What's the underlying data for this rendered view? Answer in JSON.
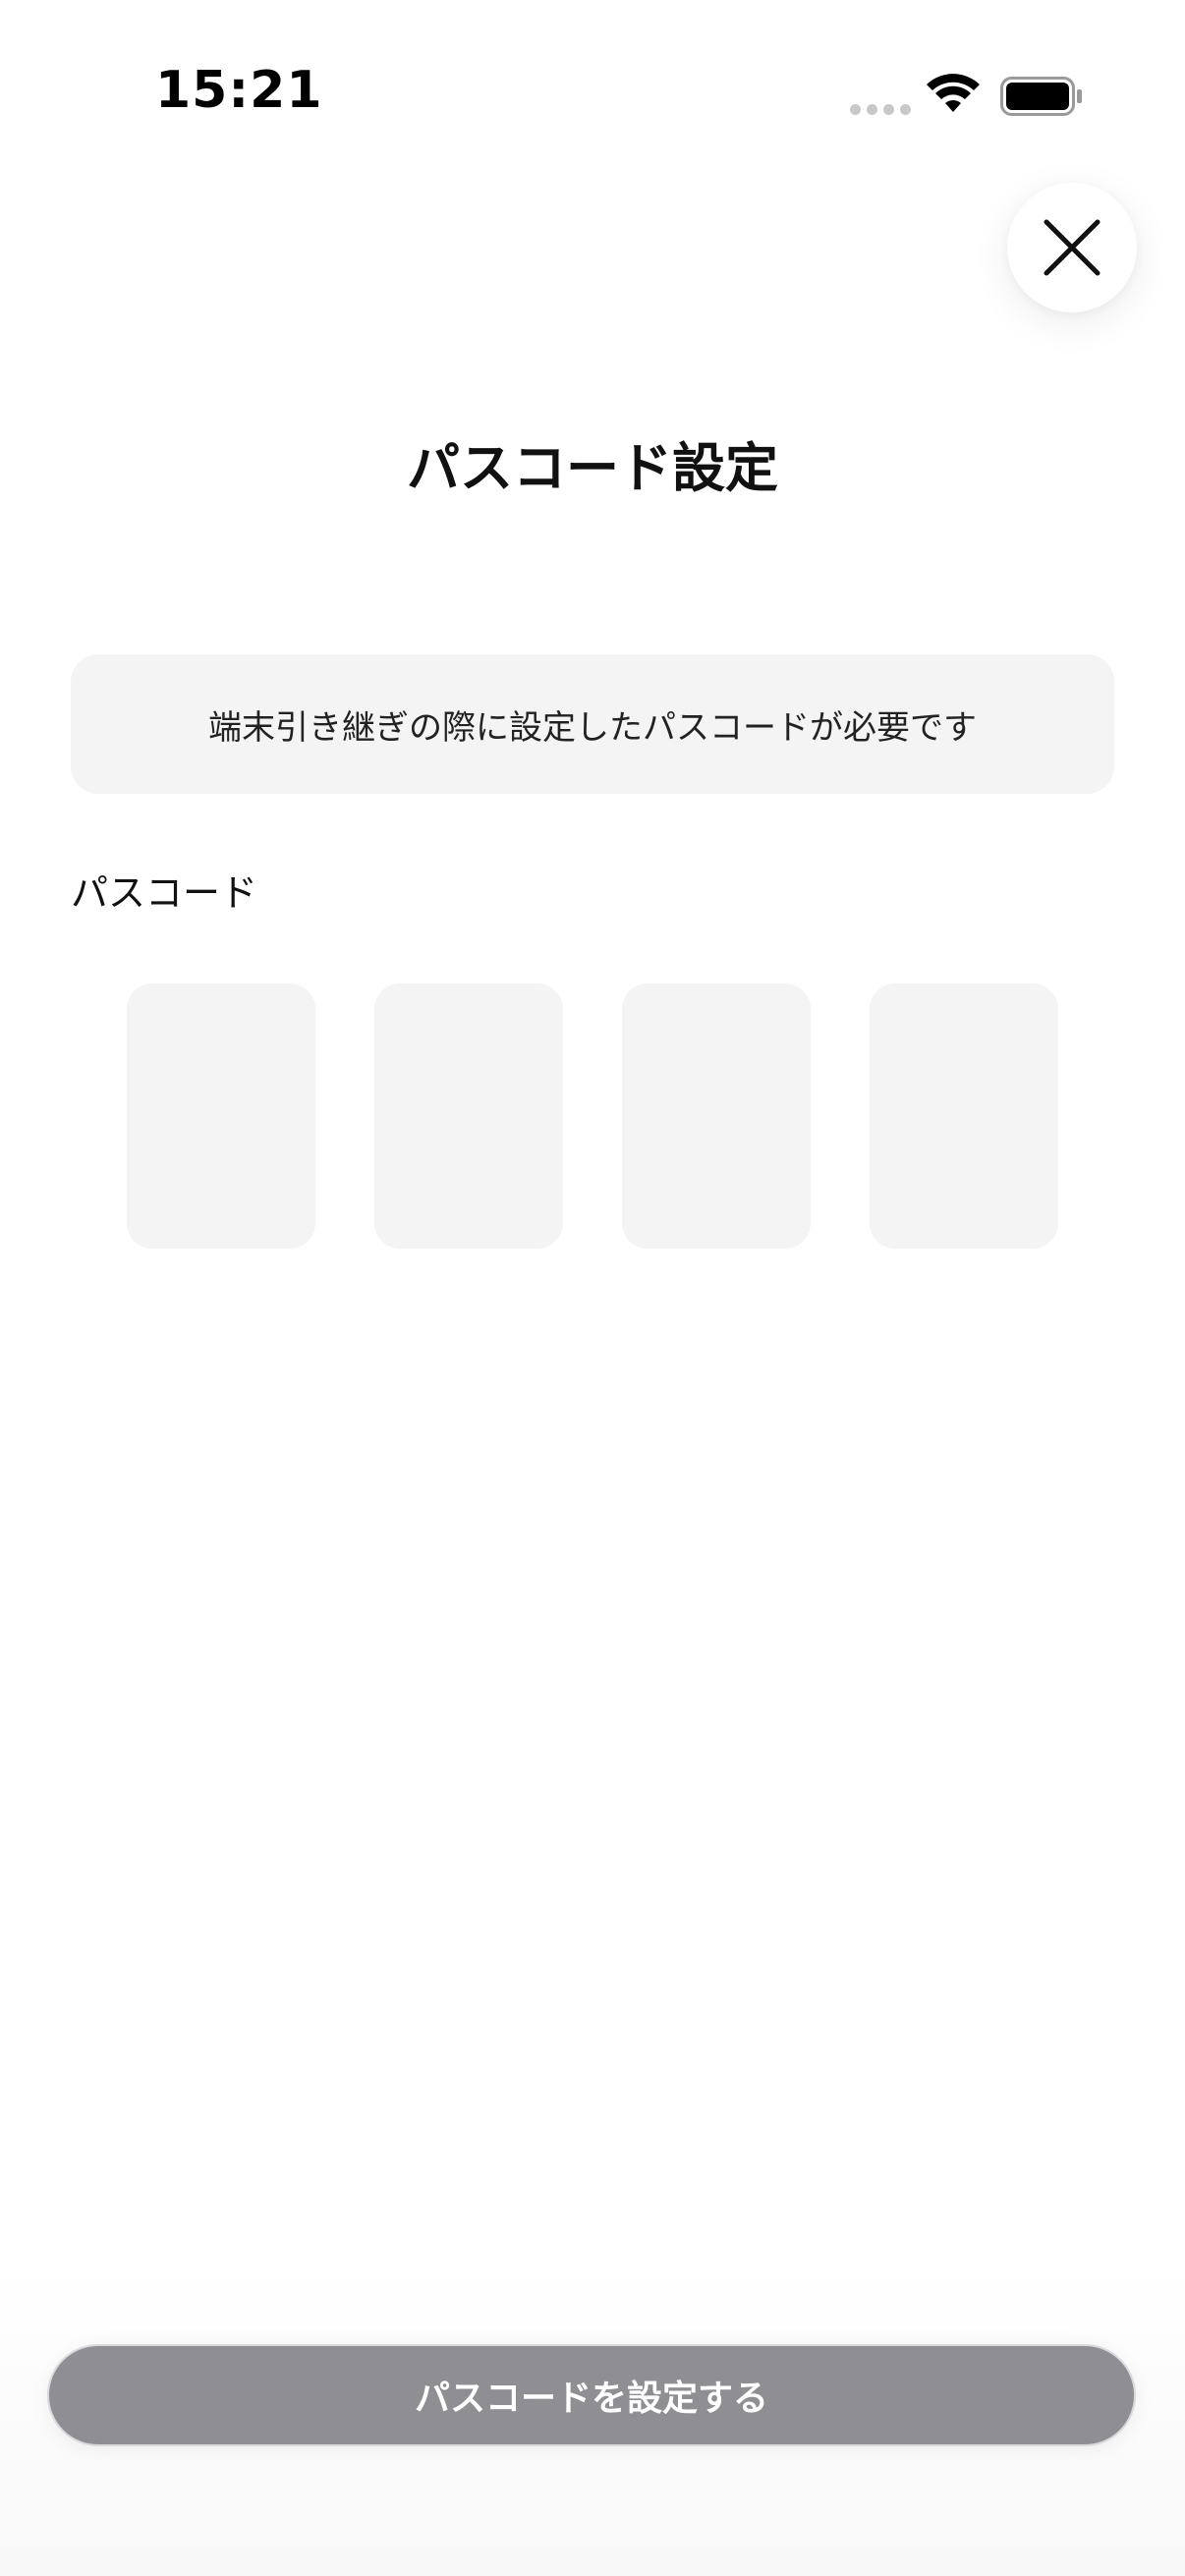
{
  "status_bar": {
    "time": "15:21"
  },
  "icons": {
    "close": "close-icon",
    "wifi": "wifi-icon",
    "battery": "battery-icon"
  },
  "page": {
    "title": "パスコード設定",
    "info": "端末引き継ぎの際に設定したパスコードが必要です",
    "passcode_label": "パスコード",
    "passcode_length": 4,
    "submit_label": "パスコードを設定する"
  },
  "colors": {
    "background": "#ffffff",
    "field_background": "#f4f4f4",
    "button_disabled": "#8e8e93",
    "text": "#111111"
  }
}
